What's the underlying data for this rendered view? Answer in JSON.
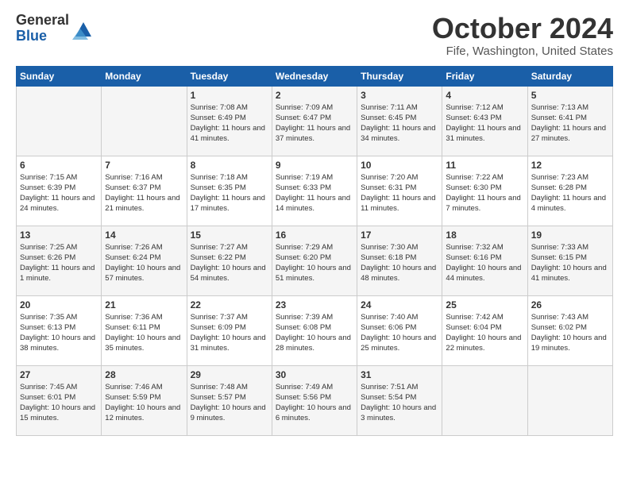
{
  "logo": {
    "general": "General",
    "blue": "Blue"
  },
  "title": "October 2024",
  "location": "Fife, Washington, United States",
  "days_header": [
    "Sunday",
    "Monday",
    "Tuesday",
    "Wednesday",
    "Thursday",
    "Friday",
    "Saturday"
  ],
  "weeks": [
    [
      {
        "day": "",
        "info": ""
      },
      {
        "day": "",
        "info": ""
      },
      {
        "day": "1",
        "info": "Sunrise: 7:08 AM\nSunset: 6:49 PM\nDaylight: 11 hours and 41 minutes."
      },
      {
        "day": "2",
        "info": "Sunrise: 7:09 AM\nSunset: 6:47 PM\nDaylight: 11 hours and 37 minutes."
      },
      {
        "day": "3",
        "info": "Sunrise: 7:11 AM\nSunset: 6:45 PM\nDaylight: 11 hours and 34 minutes."
      },
      {
        "day": "4",
        "info": "Sunrise: 7:12 AM\nSunset: 6:43 PM\nDaylight: 11 hours and 31 minutes."
      },
      {
        "day": "5",
        "info": "Sunrise: 7:13 AM\nSunset: 6:41 PM\nDaylight: 11 hours and 27 minutes."
      }
    ],
    [
      {
        "day": "6",
        "info": "Sunrise: 7:15 AM\nSunset: 6:39 PM\nDaylight: 11 hours and 24 minutes."
      },
      {
        "day": "7",
        "info": "Sunrise: 7:16 AM\nSunset: 6:37 PM\nDaylight: 11 hours and 21 minutes."
      },
      {
        "day": "8",
        "info": "Sunrise: 7:18 AM\nSunset: 6:35 PM\nDaylight: 11 hours and 17 minutes."
      },
      {
        "day": "9",
        "info": "Sunrise: 7:19 AM\nSunset: 6:33 PM\nDaylight: 11 hours and 14 minutes."
      },
      {
        "day": "10",
        "info": "Sunrise: 7:20 AM\nSunset: 6:31 PM\nDaylight: 11 hours and 11 minutes."
      },
      {
        "day": "11",
        "info": "Sunrise: 7:22 AM\nSunset: 6:30 PM\nDaylight: 11 hours and 7 minutes."
      },
      {
        "day": "12",
        "info": "Sunrise: 7:23 AM\nSunset: 6:28 PM\nDaylight: 11 hours and 4 minutes."
      }
    ],
    [
      {
        "day": "13",
        "info": "Sunrise: 7:25 AM\nSunset: 6:26 PM\nDaylight: 11 hours and 1 minute."
      },
      {
        "day": "14",
        "info": "Sunrise: 7:26 AM\nSunset: 6:24 PM\nDaylight: 10 hours and 57 minutes."
      },
      {
        "day": "15",
        "info": "Sunrise: 7:27 AM\nSunset: 6:22 PM\nDaylight: 10 hours and 54 minutes."
      },
      {
        "day": "16",
        "info": "Sunrise: 7:29 AM\nSunset: 6:20 PM\nDaylight: 10 hours and 51 minutes."
      },
      {
        "day": "17",
        "info": "Sunrise: 7:30 AM\nSunset: 6:18 PM\nDaylight: 10 hours and 48 minutes."
      },
      {
        "day": "18",
        "info": "Sunrise: 7:32 AM\nSunset: 6:16 PM\nDaylight: 10 hours and 44 minutes."
      },
      {
        "day": "19",
        "info": "Sunrise: 7:33 AM\nSunset: 6:15 PM\nDaylight: 10 hours and 41 minutes."
      }
    ],
    [
      {
        "day": "20",
        "info": "Sunrise: 7:35 AM\nSunset: 6:13 PM\nDaylight: 10 hours and 38 minutes."
      },
      {
        "day": "21",
        "info": "Sunrise: 7:36 AM\nSunset: 6:11 PM\nDaylight: 10 hours and 35 minutes."
      },
      {
        "day": "22",
        "info": "Sunrise: 7:37 AM\nSunset: 6:09 PM\nDaylight: 10 hours and 31 minutes."
      },
      {
        "day": "23",
        "info": "Sunrise: 7:39 AM\nSunset: 6:08 PM\nDaylight: 10 hours and 28 minutes."
      },
      {
        "day": "24",
        "info": "Sunrise: 7:40 AM\nSunset: 6:06 PM\nDaylight: 10 hours and 25 minutes."
      },
      {
        "day": "25",
        "info": "Sunrise: 7:42 AM\nSunset: 6:04 PM\nDaylight: 10 hours and 22 minutes."
      },
      {
        "day": "26",
        "info": "Sunrise: 7:43 AM\nSunset: 6:02 PM\nDaylight: 10 hours and 19 minutes."
      }
    ],
    [
      {
        "day": "27",
        "info": "Sunrise: 7:45 AM\nSunset: 6:01 PM\nDaylight: 10 hours and 15 minutes."
      },
      {
        "day": "28",
        "info": "Sunrise: 7:46 AM\nSunset: 5:59 PM\nDaylight: 10 hours and 12 minutes."
      },
      {
        "day": "29",
        "info": "Sunrise: 7:48 AM\nSunset: 5:57 PM\nDaylight: 10 hours and 9 minutes."
      },
      {
        "day": "30",
        "info": "Sunrise: 7:49 AM\nSunset: 5:56 PM\nDaylight: 10 hours and 6 minutes."
      },
      {
        "day": "31",
        "info": "Sunrise: 7:51 AM\nSunset: 5:54 PM\nDaylight: 10 hours and 3 minutes."
      },
      {
        "day": "",
        "info": ""
      },
      {
        "day": "",
        "info": ""
      }
    ]
  ]
}
